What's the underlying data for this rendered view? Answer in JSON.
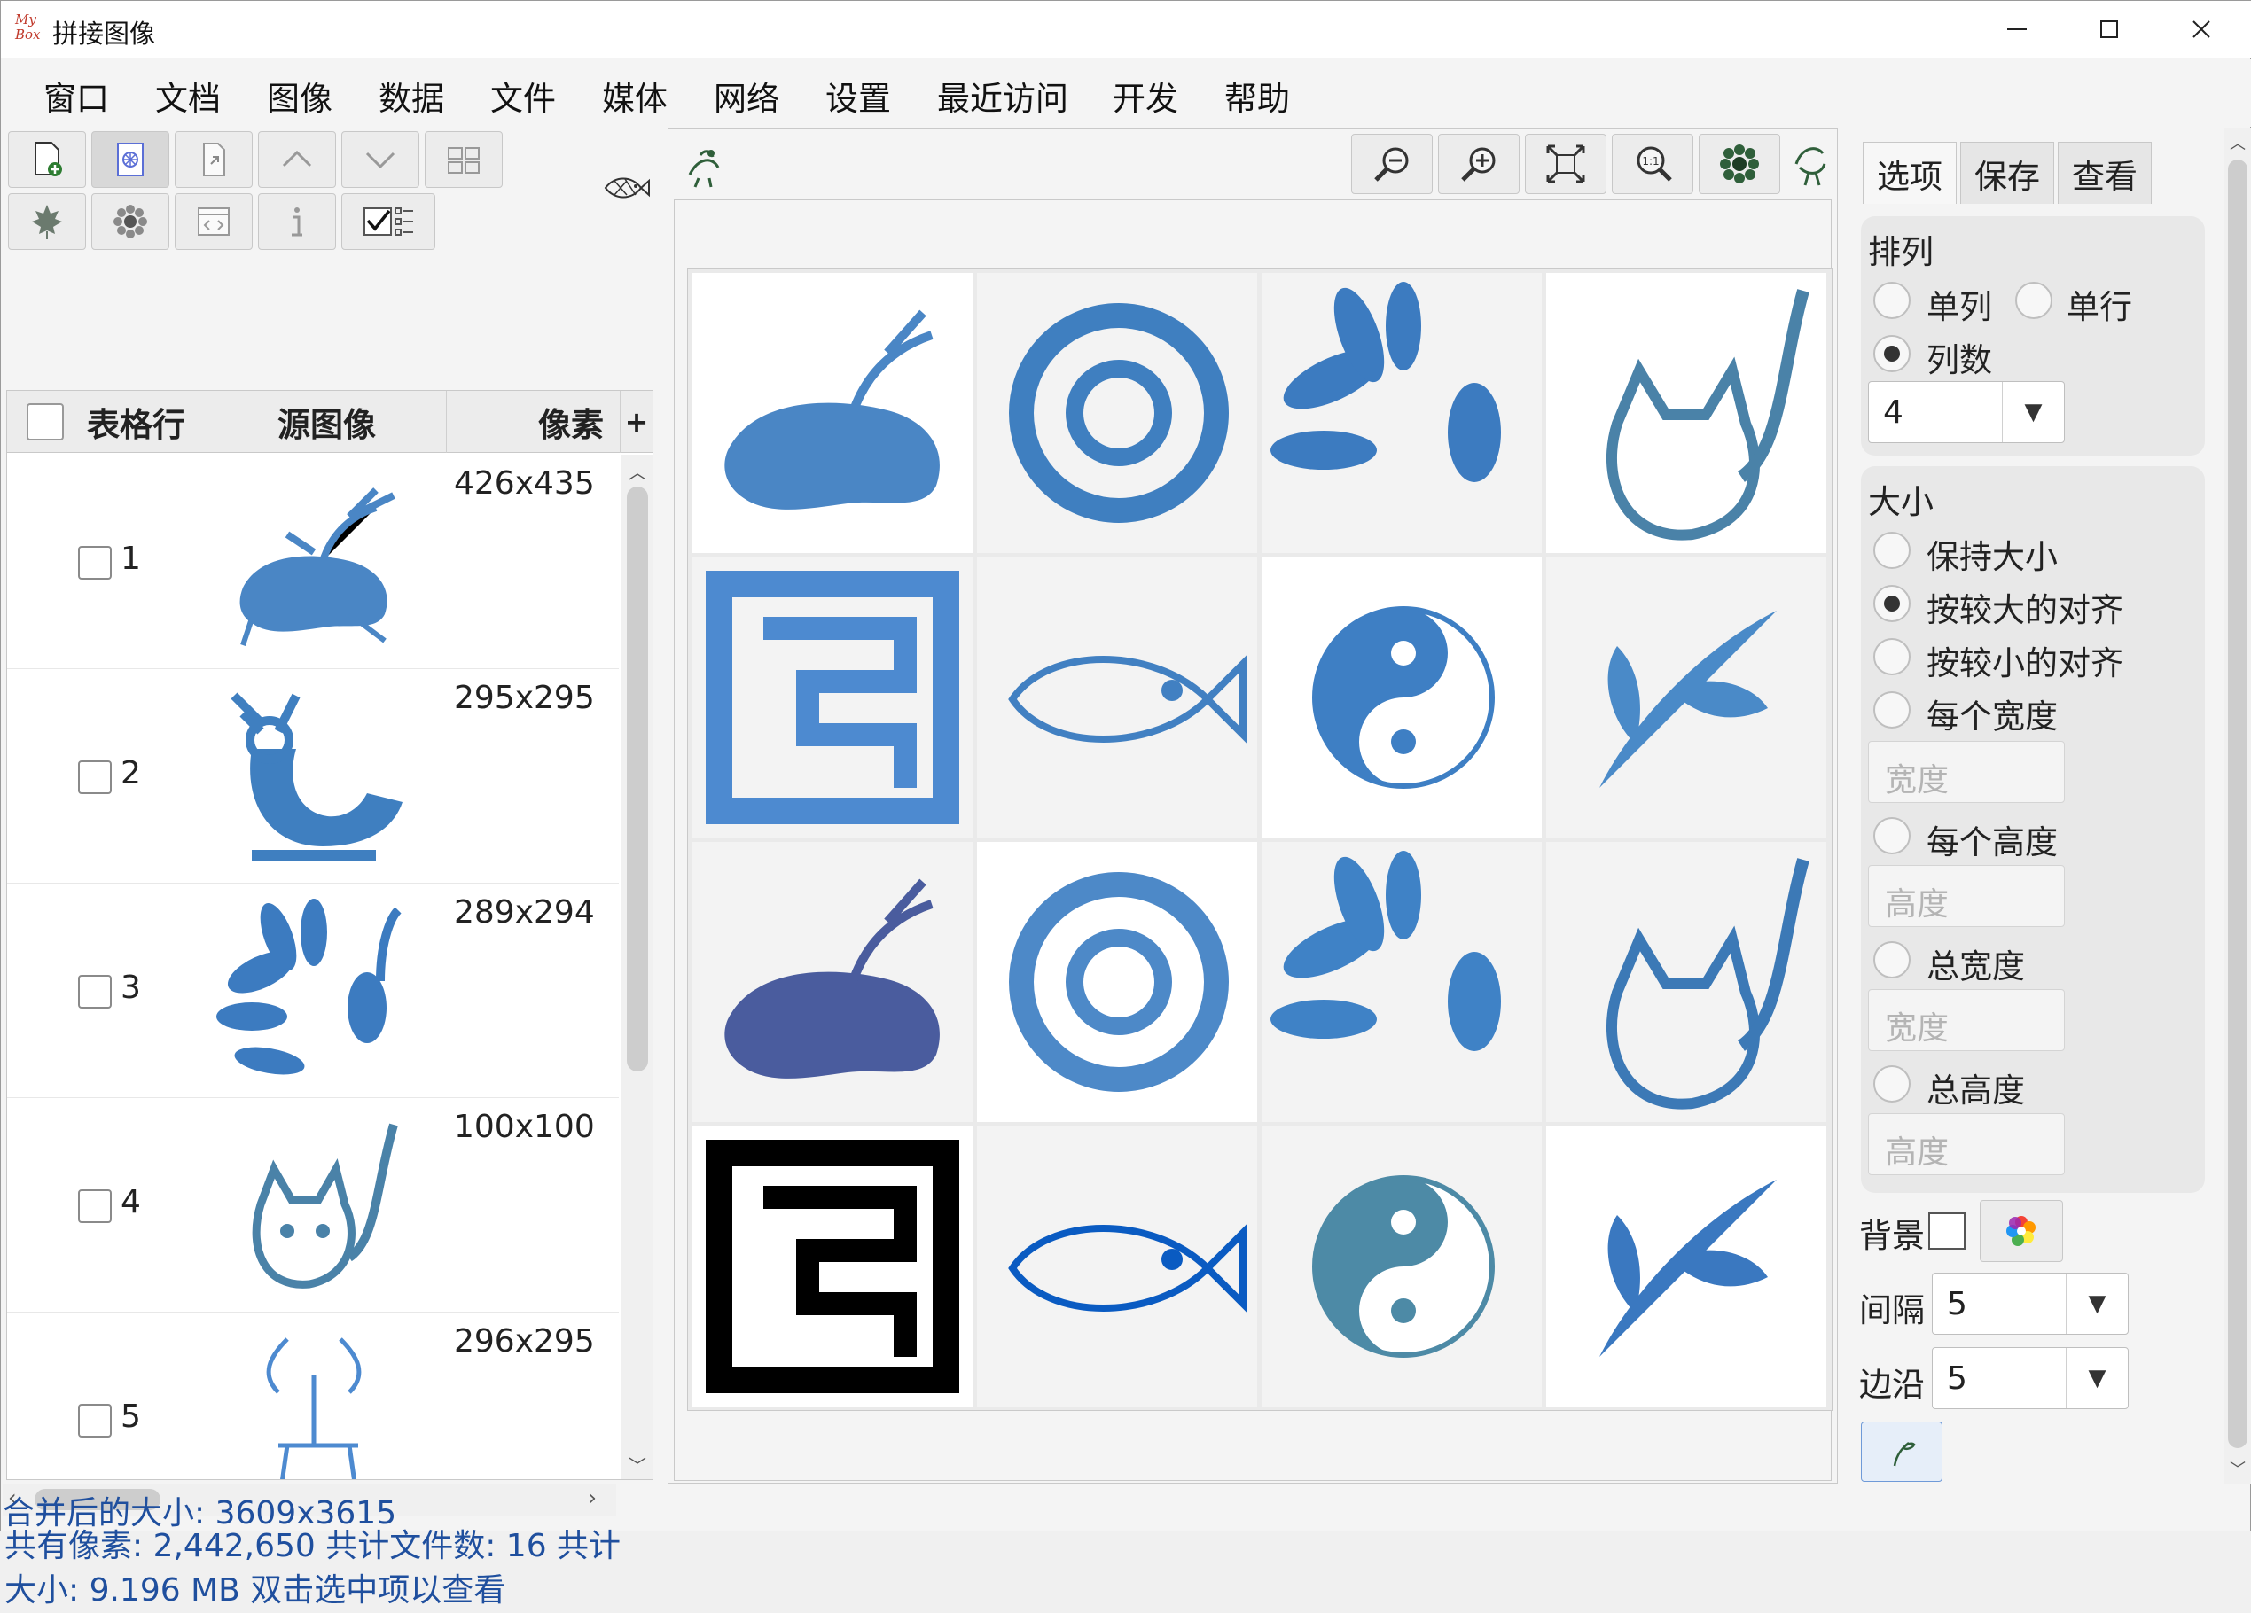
{
  "window": {
    "title": "拼接图像",
    "logo_text": "My Box"
  },
  "menu": [
    "窗口",
    "文档",
    "图像",
    "数据",
    "文件",
    "媒体",
    "网络",
    "设置",
    "最近访问",
    "开发",
    "帮助"
  ],
  "left_toolbar": {
    "row1": [
      "add-file-icon",
      "image-file-icon",
      "file-export-icon",
      "move-up-icon",
      "move-down-icon",
      "images-icon"
    ],
    "row2": [
      "maple-leaf-icon",
      "sunflower-icon",
      "code-window-icon",
      "info-icon",
      "checklist-icon"
    ],
    "side_icon": "fish-icon"
  },
  "table": {
    "headers": {
      "row": "表格行",
      "image": "源图像",
      "pixels": "像素",
      "add": "+"
    },
    "rows": [
      {
        "index": "1",
        "pixels": "426x435",
        "thumb": "deer-icon"
      },
      {
        "index": "2",
        "pixels": "295x295",
        "thumb": "deer-bird-icon"
      },
      {
        "index": "3",
        "pixels": "289x294",
        "thumb": "peacock-icon"
      },
      {
        "index": "4",
        "pixels": "100x100",
        "thumb": "cat-icon"
      },
      {
        "index": "5",
        "pixels": "296x295",
        "thumb": "deer-outline-icon"
      }
    ]
  },
  "status": {
    "summary": "共有像素: 2,442,650  共计文件数: 16  共计大小:  9.196 MB  双击选中项以查看",
    "merged": "合并后的大小: 3609x3615"
  },
  "viewer": {
    "toolbar": [
      "zoom-out-icon",
      "zoom-in-icon",
      "fit-icon",
      "actual-size-icon",
      "flower-icon"
    ],
    "grid_colors": [
      "#4a86c5",
      "#3f7fc0",
      "#3c7bc0",
      "#4a82a8",
      "#4d8ad0",
      "#4180c2",
      "#3e7fc4",
      "#4a8ac8",
      "#4a5c9e",
      "#4d89c8",
      "#3f82c6",
      "#3c79b6",
      "#000000",
      "#0a5bc2",
      "#4d8aa6",
      "#3a78c0"
    ]
  },
  "right": {
    "tabs": [
      "选项",
      "保存",
      "查看"
    ],
    "arrange": {
      "title": "排列",
      "single_col": "单列",
      "single_row": "单行",
      "columns": "列数",
      "columns_value": "4"
    },
    "size": {
      "title": "大小",
      "keep": "保持大小",
      "align_larger": "按较大的对齐",
      "align_smaller": "按较小的对齐",
      "each_width": "每个宽度",
      "width_placeholder": "宽度",
      "each_height": "每个高度",
      "height_placeholder": "高度",
      "total_width": "总宽度",
      "total_height": "总高度"
    },
    "background": "背景",
    "spacing": {
      "label": "间隔",
      "value": "5"
    },
    "margin": {
      "label": "边沿",
      "value": "5"
    }
  }
}
